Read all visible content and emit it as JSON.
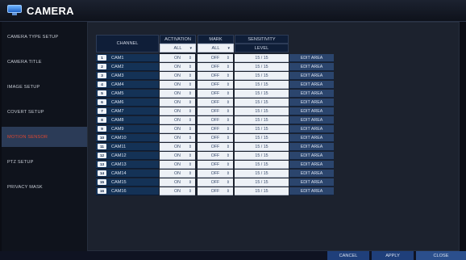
{
  "app": {
    "title": "CAMERA",
    "icon": "monitor-icon"
  },
  "sidebar": {
    "items": [
      {
        "label": "CAMERA TYPE SETUP",
        "active": false
      },
      {
        "label": "CAMERA TITLE",
        "active": false
      },
      {
        "label": "IMAGE SETUP",
        "active": false
      },
      {
        "label": "COVERT SETUP",
        "active": false
      },
      {
        "label": "MOTION SENSOR",
        "active": true
      },
      {
        "label": "PTZ SETUP",
        "active": false
      },
      {
        "label": "PRIVACY MASK",
        "active": false
      }
    ]
  },
  "table": {
    "headers": {
      "channel": "CHANNEL",
      "activation": "ACTIVATION",
      "mark": "MARK",
      "sensitivity": "SENSITIVITY"
    },
    "subheaders": {
      "activation": "ALL",
      "mark": "ALL",
      "sensitivity": "LEVEL"
    },
    "rows": [
      {
        "num": "1",
        "name": "CAM1",
        "activation": "ON",
        "mark": "OFF",
        "level": "15 / 15",
        "edit": "EDIT AREA"
      },
      {
        "num": "2",
        "name": "CAM2",
        "activation": "ON",
        "mark": "OFF",
        "level": "15 / 15",
        "edit": "EDIT AREA"
      },
      {
        "num": "3",
        "name": "CAM3",
        "activation": "ON",
        "mark": "OFF",
        "level": "15 / 15",
        "edit": "EDIT AREA"
      },
      {
        "num": "4",
        "name": "CAM4",
        "activation": "ON",
        "mark": "OFF",
        "level": "15 / 15",
        "edit": "EDIT AREA"
      },
      {
        "num": "5",
        "name": "CAM5",
        "activation": "ON",
        "mark": "OFF",
        "level": "15 / 15",
        "edit": "EDIT AREA"
      },
      {
        "num": "6",
        "name": "CAM6",
        "activation": "ON",
        "mark": "OFF",
        "level": "15 / 15",
        "edit": "EDIT AREA"
      },
      {
        "num": "7",
        "name": "CAM7",
        "activation": "ON",
        "mark": "OFF",
        "level": "15 / 15",
        "edit": "EDIT AREA"
      },
      {
        "num": "8",
        "name": "CAM8",
        "activation": "ON",
        "mark": "OFF",
        "level": "15 / 15",
        "edit": "EDIT AREA"
      },
      {
        "num": "9",
        "name": "CAM9",
        "activation": "ON",
        "mark": "OFF",
        "level": "15 / 15",
        "edit": "EDIT AREA"
      },
      {
        "num": "10",
        "name": "CAM10",
        "activation": "ON",
        "mark": "OFF",
        "level": "15 / 15",
        "edit": "EDIT AREA"
      },
      {
        "num": "11",
        "name": "CAM11",
        "activation": "ON",
        "mark": "OFF",
        "level": "15 / 15",
        "edit": "EDIT AREA"
      },
      {
        "num": "12",
        "name": "CAM12",
        "activation": "ON",
        "mark": "OFF",
        "level": "15 / 15",
        "edit": "EDIT AREA"
      },
      {
        "num": "13",
        "name": "CAM13",
        "activation": "ON",
        "mark": "OFF",
        "level": "15 / 15",
        "edit": "EDIT AREA"
      },
      {
        "num": "14",
        "name": "CAM14",
        "activation": "ON",
        "mark": "OFF",
        "level": "15 / 15",
        "edit": "EDIT AREA"
      },
      {
        "num": "15",
        "name": "CAM15",
        "activation": "ON",
        "mark": "OFF",
        "level": "15 / 15",
        "edit": "EDIT AREA"
      },
      {
        "num": "16",
        "name": "CAM16",
        "activation": "ON",
        "mark": "OFF",
        "level": "15 / 15",
        "edit": "EDIT AREA"
      }
    ]
  },
  "footer": {
    "cancel": "CANCEL",
    "apply": "APPLY",
    "close": "CLOSE"
  },
  "colors": {
    "accent": "#e0472f",
    "selected_bg": "#2b3b57",
    "header_bg": "#0f1e38"
  }
}
